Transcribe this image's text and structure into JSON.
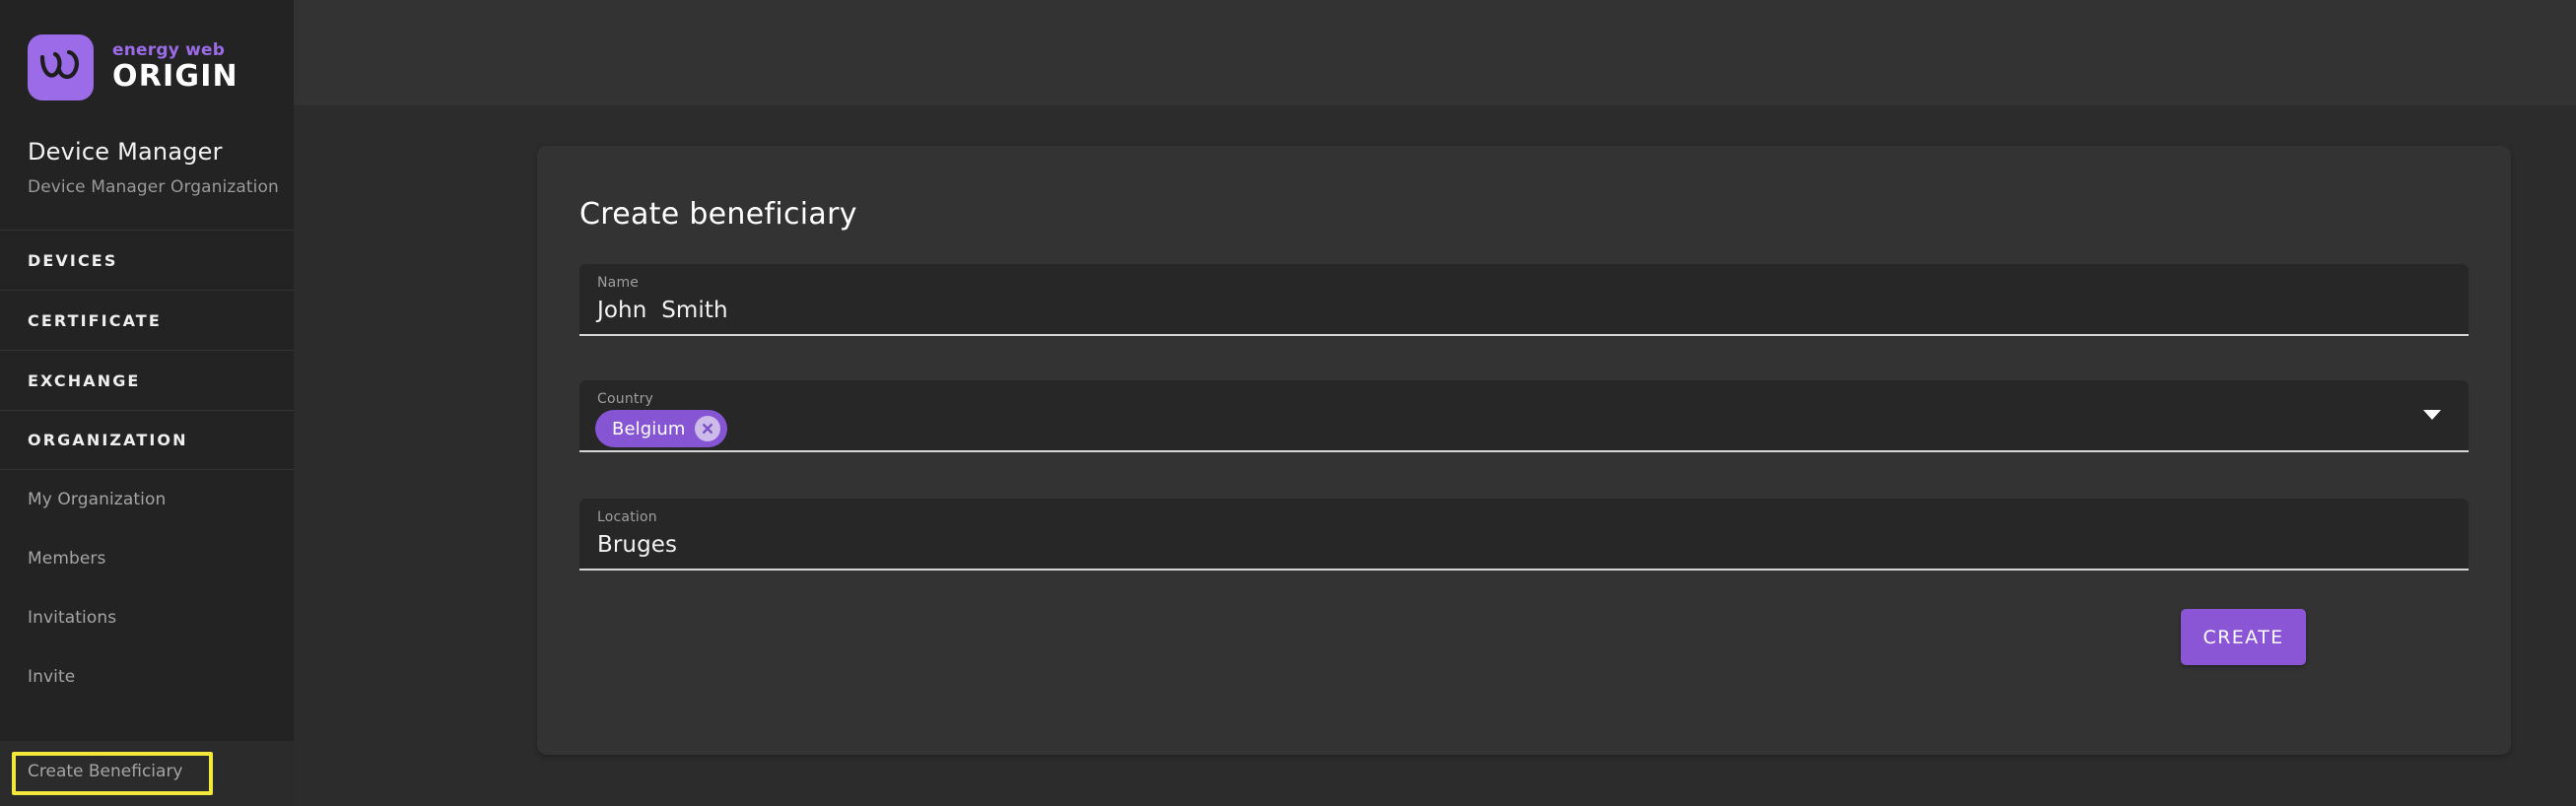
{
  "brand": {
    "logo_top": "energy web",
    "logo_bottom": "ORIGIN",
    "logo_icon": "energy-web-w-mark-icon",
    "logo_bg_color": "#9B6BE8",
    "accent_color": "#8A56D6"
  },
  "sidebar": {
    "org_title": "Device Manager",
    "org_subtitle": "Device Manager Organization",
    "sections": [
      {
        "label": "DEVICES"
      },
      {
        "label": "CERTIFICATE"
      },
      {
        "label": "EXCHANGE"
      },
      {
        "label": "ORGANIZATION"
      }
    ],
    "sub_items": [
      {
        "label": "My Organization"
      },
      {
        "label": "Members"
      },
      {
        "label": "Invitations"
      },
      {
        "label": "Invite"
      }
    ],
    "active_item": {
      "label": "Create Beneficiary",
      "highlight_color": "#F2E83C"
    }
  },
  "topbar": {},
  "main": {
    "card_title": "Create beneficiary",
    "fields": [
      {
        "label": "Name",
        "value": "John  Smith",
        "placeholder": "Name"
      },
      {
        "label": "Country",
        "value": "",
        "placeholder": "Country"
      },
      {
        "label": "Location",
        "value": "Bruges",
        "placeholder": "Location"
      }
    ],
    "country_chip": {
      "label": "Belgium",
      "remove_icon": "close-circle-icon",
      "chip_color": "#8655D4"
    },
    "dropdown_icon": "chevron-down-icon",
    "submit_label": "CREATE"
  }
}
